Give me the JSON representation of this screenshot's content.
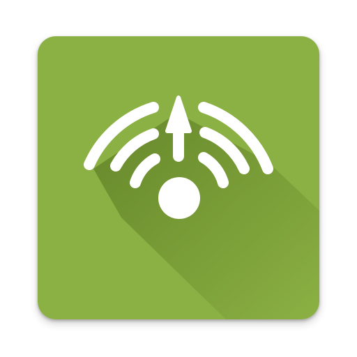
{
  "app_icon": {
    "icon": "wifi-signal-upload-icon",
    "colors": {
      "tile": "#8bb043",
      "long_shadow": "#5f8026",
      "glyph": "#ffffff"
    }
  }
}
